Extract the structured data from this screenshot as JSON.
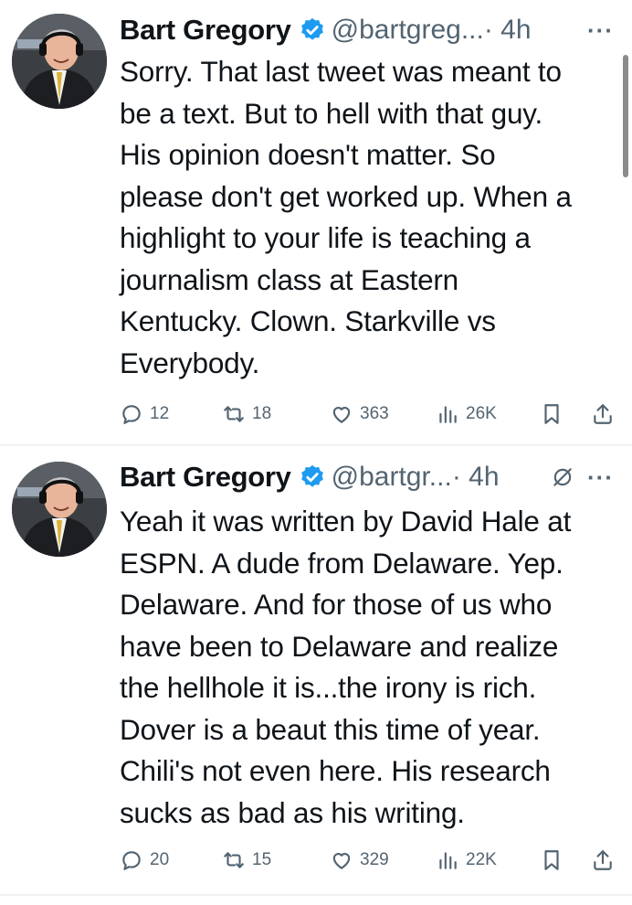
{
  "tweets": [
    {
      "author_name": "Bart Gregory",
      "handle": "@bartgreg...",
      "time": "· 4h",
      "more_label": "···",
      "text": "Sorry. That last tweet was meant to\nbe a text. But to hell with that guy.\nHis opinion doesn't matter. So\nplease don't get worked up. When a\nhighlight to your life is teaching a\njournalism class at Eastern\nKentucky. Clown. Starkville vs\nEverybody.",
      "stats": {
        "replies": "12",
        "reposts": "18",
        "likes": "363",
        "views": "26K"
      }
    },
    {
      "author_name": "Bart Gregory",
      "handle": "@bartgr...",
      "time": "· 4h",
      "more_label": "···",
      "text": "Yeah it was written by David Hale at\nESPN. A dude from Delaware. Yep.\nDelaware. And for those of us who\nhave been to Delaware and realize\nthe hellhole it is...the irony is rich.\nDover is a beaut this time of year.\nChili's not even here. His research\nsucks as bad as his writing.",
      "stats": {
        "replies": "20",
        "reposts": "15",
        "likes": "329",
        "views": "22K"
      }
    }
  ],
  "colors": {
    "text": "#0f1419",
    "secondary": "#536471",
    "verified_badge": "#1d9bf0",
    "divider": "#eff3f4"
  },
  "icons": [
    "verified-badge",
    "reply-icon",
    "repost-icon",
    "like-icon",
    "views-icon",
    "bookmark-icon",
    "share-icon",
    "grok-icon",
    "more-icon"
  ]
}
